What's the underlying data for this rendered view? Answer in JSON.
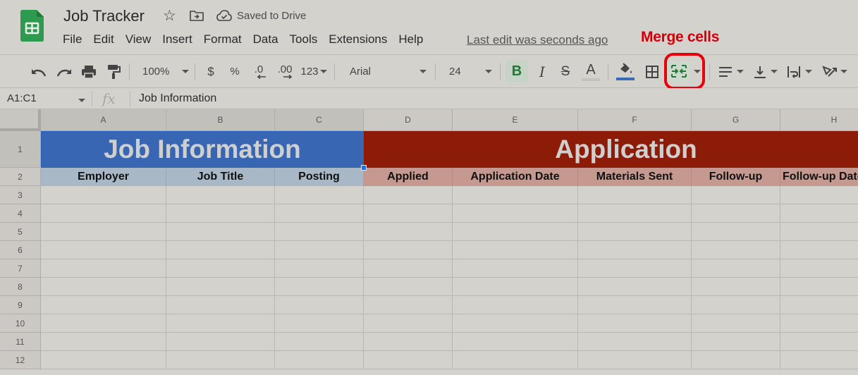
{
  "app": {
    "title": "Job Tracker",
    "saved_status": "Saved to Drive",
    "last_edit": "Last edit was seconds ago",
    "annotation": "Merge cells",
    "menu": [
      "File",
      "Edit",
      "View",
      "Insert",
      "Format",
      "Data",
      "Tools",
      "Extensions",
      "Help"
    ]
  },
  "toolbar": {
    "zoom": "100%",
    "currency": "$",
    "percent": "%",
    "decrease_decimal": ".0",
    "increase_decimal": ".00",
    "more_formats": "123",
    "font": "Arial",
    "font_size": "24",
    "bold": "B",
    "italic": "I",
    "strikethrough": "S",
    "text_color": "A",
    "fill_color": "#3b6bb5",
    "bold_active": true,
    "merge_highlighted": true
  },
  "formula_bar": {
    "name_box": "A1:C1",
    "fx": "fx",
    "value": "Job Information"
  },
  "sheet": {
    "columns": [
      "A",
      "B",
      "C",
      "D",
      "E",
      "F",
      "G",
      "H"
    ],
    "rows": [
      "1",
      "2",
      "3",
      "4",
      "5",
      "6",
      "7",
      "8",
      "9",
      "10",
      "11",
      "12"
    ],
    "selected_range": "A1:C1",
    "merged_headers": [
      {
        "label": "Job Information",
        "range": "A1:C1",
        "bg": "#3866b3"
      },
      {
        "label": "Application",
        "range": "D1:H1",
        "bg": "#8c1b07"
      }
    ],
    "subheaders": [
      {
        "label": "Employer",
        "bg": "#a9b8c6"
      },
      {
        "label": "Job Title",
        "bg": "#a9b8c6"
      },
      {
        "label": "Posting",
        "bg": "#a9b8c6"
      },
      {
        "label": "Applied",
        "bg": "#c5998f"
      },
      {
        "label": "Application Date",
        "bg": "#c5998f"
      },
      {
        "label": "Materials Sent",
        "bg": "#c5998f"
      },
      {
        "label": "Follow-up",
        "bg": "#c5998f"
      },
      {
        "label": "Follow-up Date",
        "bg": "#c5998f"
      }
    ]
  }
}
